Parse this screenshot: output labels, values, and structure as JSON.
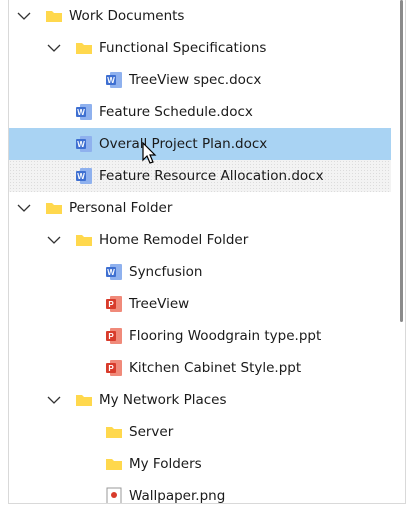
{
  "tree": {
    "nodes": [
      {
        "label": "Work Documents",
        "type": "folder",
        "expanded": true,
        "level": 0
      },
      {
        "label": "Functional Specifications",
        "type": "folder",
        "expanded": true,
        "level": 1
      },
      {
        "label": "TreeView spec.docx",
        "type": "word",
        "level": 2
      },
      {
        "label": "Feature Schedule.docx",
        "type": "word",
        "level": 1
      },
      {
        "label": "Overall Project Plan.docx",
        "type": "word",
        "level": 1,
        "selected": true
      },
      {
        "label": "Feature Resource Allocation.docx",
        "type": "word",
        "level": 1,
        "hovered": true
      },
      {
        "label": "Personal Folder",
        "type": "folder",
        "expanded": true,
        "level": 0
      },
      {
        "label": "Home Remodel Folder",
        "type": "folder",
        "expanded": true,
        "level": 1
      },
      {
        "label": "Syncfusion",
        "type": "word",
        "level": 2
      },
      {
        "label": "TreeView",
        "type": "ppt",
        "level": 2
      },
      {
        "label": "Flooring Woodgrain type.ppt",
        "type": "ppt",
        "level": 2
      },
      {
        "label": "Kitchen Cabinet Style.ppt",
        "type": "ppt",
        "level": 2
      },
      {
        "label": "My Network Places",
        "type": "folder",
        "expanded": true,
        "level": 1
      },
      {
        "label": "Server",
        "type": "folder",
        "level": 2
      },
      {
        "label": "My Folders",
        "type": "folder",
        "level": 2
      },
      {
        "label": "Wallpaper.png",
        "type": "image",
        "level": 2
      }
    ]
  },
  "colors": {
    "selected_bg": "#a9d3f3",
    "folder": "#ffd84d",
    "word": "#3e6fd1",
    "ppt": "#d83b2b"
  }
}
